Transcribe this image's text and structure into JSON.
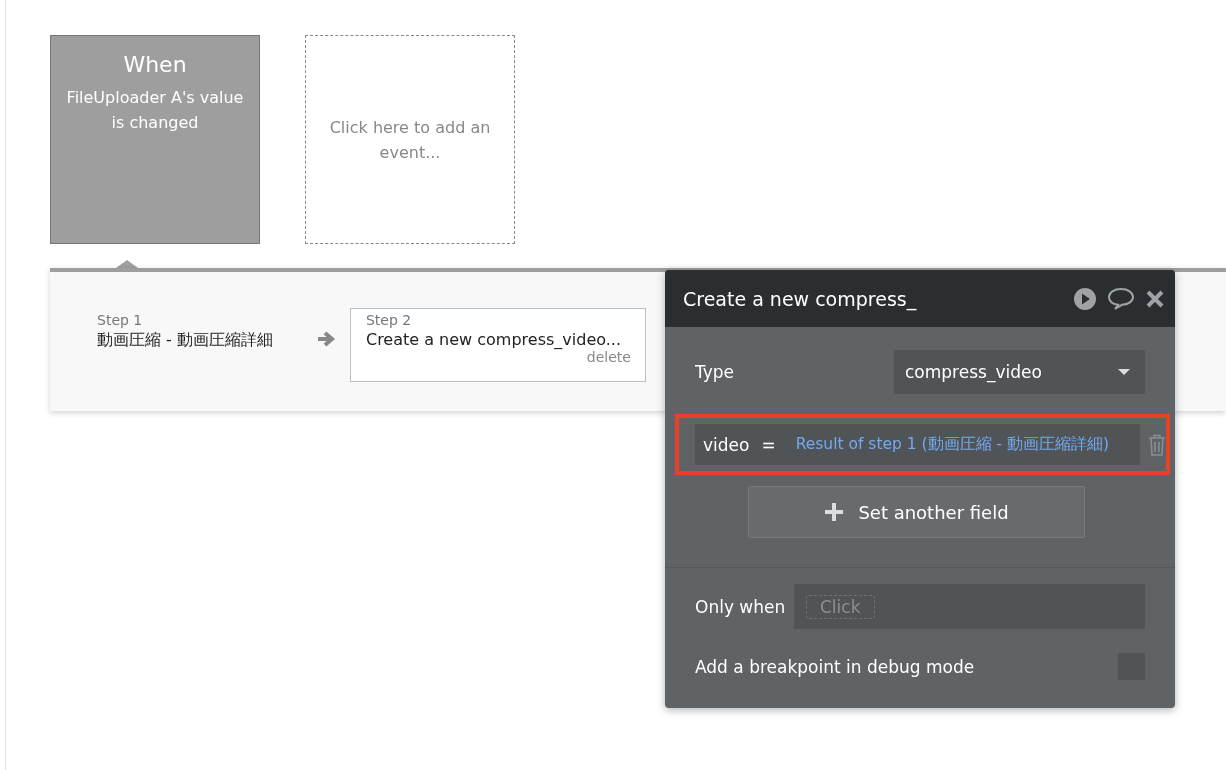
{
  "events": [
    {
      "kind": "trigger",
      "selected": true,
      "title": "When",
      "description": "FileUploader A's value is changed"
    },
    {
      "kind": "add",
      "selected": false,
      "description": "Click here to add an event..."
    }
  ],
  "steps": [
    {
      "label": "Step 1",
      "name": "動画圧縮 - 動画圧縮詳細",
      "selected": false
    },
    {
      "label": "Step 2",
      "name": "Create a new compress_video...",
      "selected": true,
      "delete": "delete"
    }
  ],
  "panel": {
    "title": "Create a new compress_",
    "type_label": "Type",
    "type_value": "compress_video",
    "fields": [
      {
        "name": "video",
        "operator": "=",
        "value": "Result of step 1 (動画圧縮 - 動画圧縮詳細)",
        "highlighted": true
      }
    ],
    "add_field_button": "Set another field",
    "only_when_label": "Only when",
    "only_when_placeholder": "Click",
    "breakpoint_label": "Add a breakpoint in debug mode",
    "breakpoint_checked": false
  }
}
